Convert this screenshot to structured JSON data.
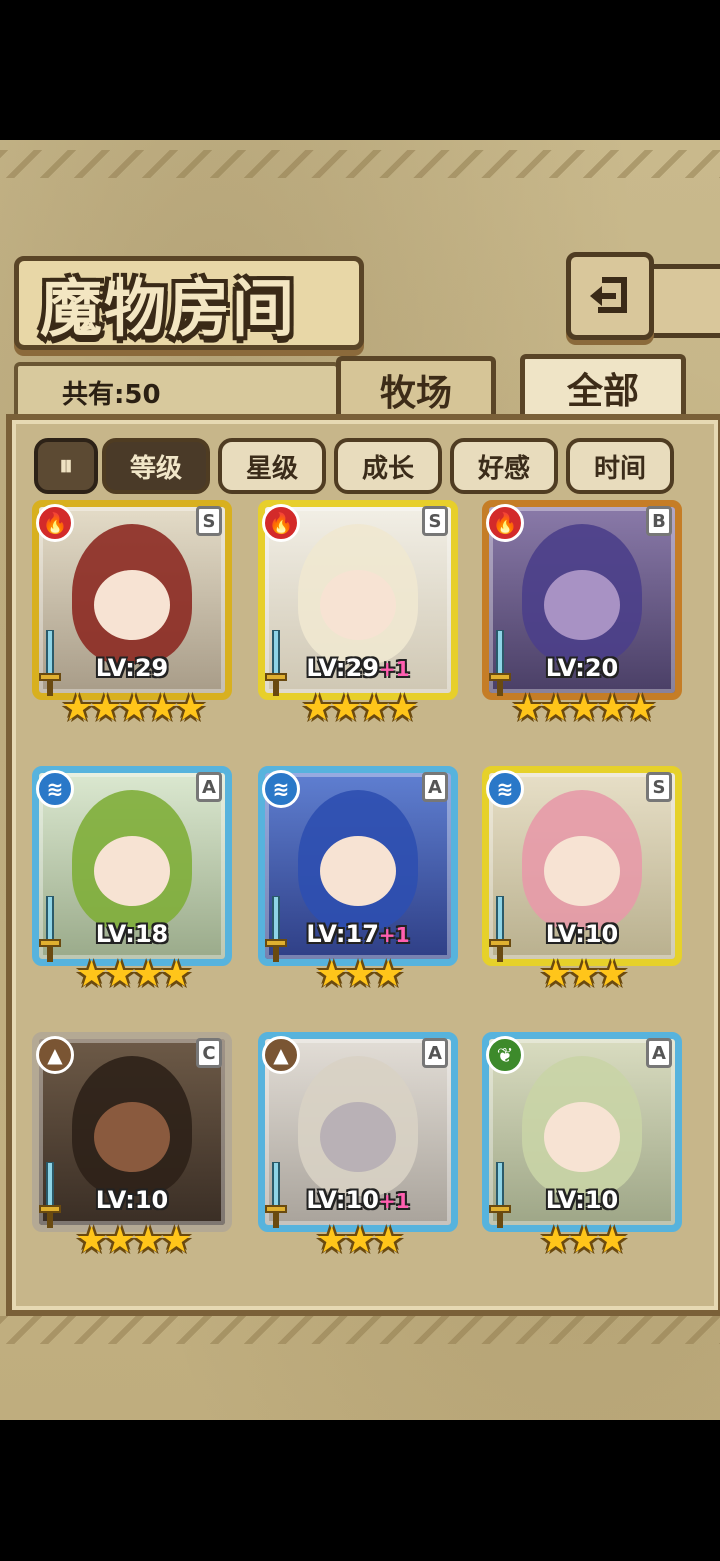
{
  "header": {
    "title": "魔物房间",
    "count_label": "共有:50"
  },
  "tabs": [
    {
      "label": "牧场",
      "active": false
    },
    {
      "label": "全部",
      "active": true
    }
  ],
  "sort": {
    "toggle_label": "⏸",
    "buttons": [
      {
        "label": "等级",
        "active": true
      },
      {
        "label": "星级",
        "active": false
      },
      {
        "label": "成长",
        "active": false
      },
      {
        "label": "好感",
        "active": false
      },
      {
        "label": "时间",
        "active": false
      }
    ]
  },
  "monsters": [
    {
      "level": "LV:29",
      "plus": "",
      "rank": "S",
      "element": "fire",
      "stars": "★★★★★"
    },
    {
      "level": "LV:29",
      "plus": "+1",
      "rank": "S",
      "element": "fire",
      "stars": "★★★★"
    },
    {
      "level": "LV:20",
      "plus": "",
      "rank": "B",
      "element": "fire",
      "stars": "★★★★★"
    },
    {
      "level": "LV:18",
      "plus": "",
      "rank": "A",
      "element": "water",
      "stars": "★★★★"
    },
    {
      "level": "LV:17",
      "plus": "+1",
      "rank": "A",
      "element": "water",
      "stars": "★★★"
    },
    {
      "level": "LV:10",
      "plus": "",
      "rank": "S",
      "element": "water",
      "stars": "★★★"
    },
    {
      "level": "LV:10",
      "plus": "",
      "rank": "C",
      "element": "earth",
      "stars": "★★★★"
    },
    {
      "level": "LV:10",
      "plus": "+1",
      "rank": "A",
      "element": "earth",
      "stars": "★★★"
    },
    {
      "level": "LV:10",
      "plus": "",
      "rank": "A",
      "element": "wood",
      "stars": "★★★"
    }
  ],
  "colors": {
    "fire": "#d32a2a",
    "water": "#2a78c8",
    "earth": "#7a5533",
    "wood": "#3d8a2b"
  }
}
